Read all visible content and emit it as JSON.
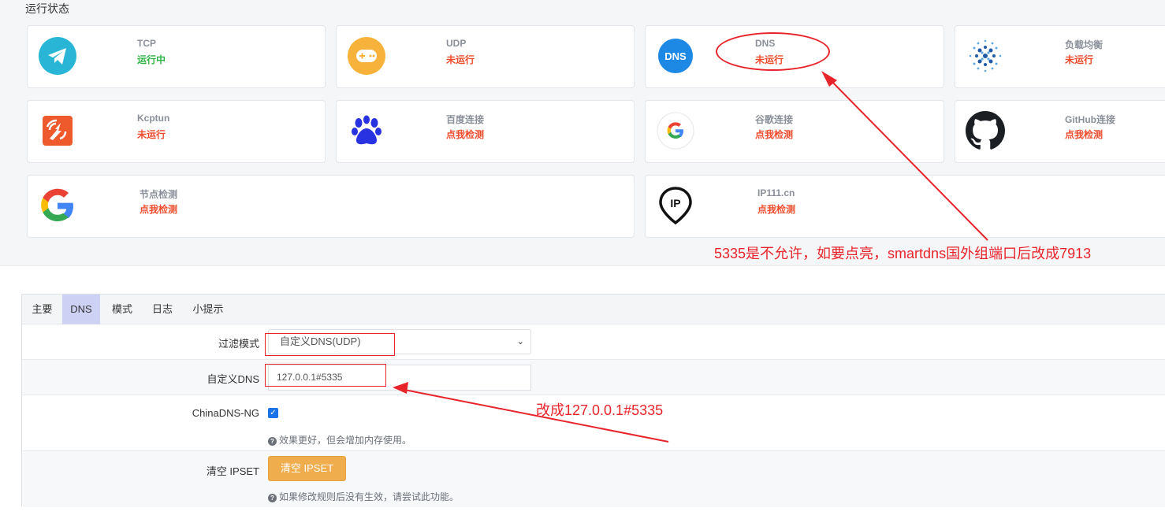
{
  "status": {
    "title": "运行状态",
    "cards": [
      {
        "name": "TCP",
        "state": "运行中",
        "icon": "telegram-icon"
      },
      {
        "name": "UDP",
        "state": "未运行",
        "icon": "gamepad-icon"
      },
      {
        "name": "DNS",
        "state": "未运行",
        "icon": "dns-icon",
        "icon_text": "DNS"
      },
      {
        "name": "负载均衡",
        "state": "未运行",
        "icon": "load-balance-icon"
      },
      {
        "name": "Kcptun",
        "state": "未运行",
        "icon": "kcptun-icon"
      },
      {
        "name": "百度连接",
        "state": "点我检测",
        "icon": "baidu-paw-icon"
      },
      {
        "name": "谷歌连接",
        "state": "点我检测",
        "icon": "google-icon"
      },
      {
        "name": "GitHub连接",
        "state": "点我检测",
        "icon": "github-icon"
      },
      {
        "name": "节点检测",
        "state": "点我检测",
        "icon": "google-icon"
      },
      {
        "name": "IP111.cn",
        "state": "点我检测",
        "icon": "ip-pin-icon",
        "icon_text": "IP"
      }
    ]
  },
  "tabs": [
    {
      "label": "主要",
      "active": false
    },
    {
      "label": "DNS",
      "active": true
    },
    {
      "label": "模式",
      "active": false
    },
    {
      "label": "日志",
      "active": false
    },
    {
      "label": "小提示",
      "active": false
    }
  ],
  "form": {
    "filter_mode": {
      "label": "过滤模式",
      "value": "自定义DNS(UDP)"
    },
    "custom_dns": {
      "label": "自定义DNS",
      "value": "127.0.0.1#5335"
    },
    "chinadns": {
      "label": "ChinaDNS-NG",
      "checked": true,
      "hint": "效果更好，但会增加内存使用。"
    },
    "clear_ipset": {
      "label": "清空 IPSET",
      "button": "清空 IPSET",
      "hint": "如果修改规则后没有生效，请尝试此功能。"
    }
  },
  "annotations": {
    "dns_note": "5335是不允许，如要点亮，smartdns国外组端口后改成7913",
    "custom_dns_note": "改成127.0.0.1#5335",
    "color": "#e8242b"
  },
  "colors": {
    "running": "#2fb344",
    "stopped": "#ee4b2b",
    "active_tab": "#cdd2f5",
    "button": "#f0ad4e"
  }
}
